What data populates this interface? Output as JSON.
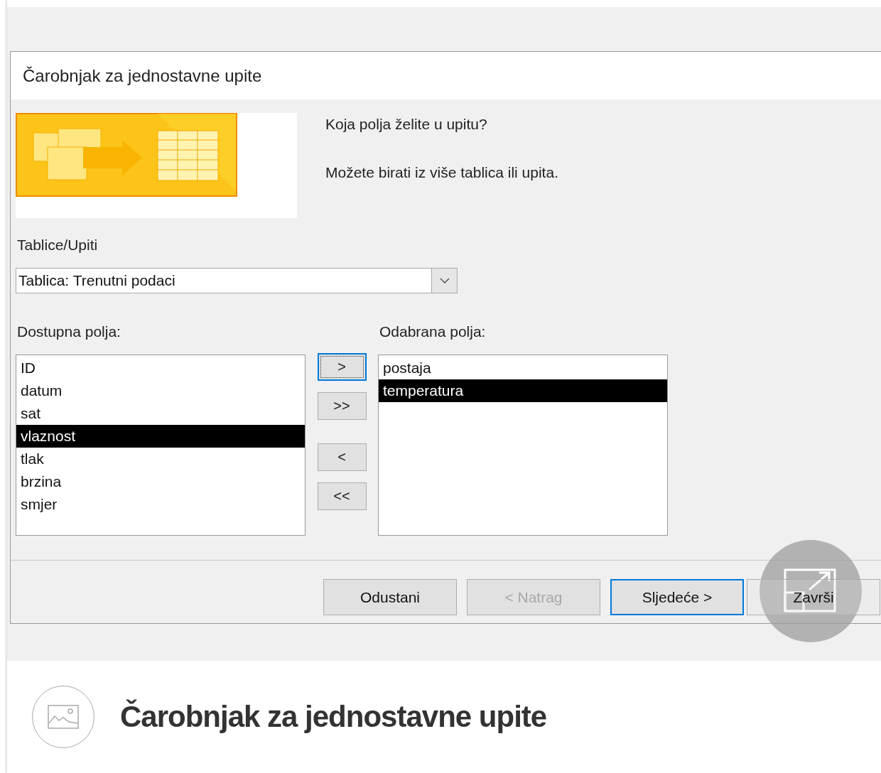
{
  "window": {
    "title": "Čarobnjak za jednostavne upite"
  },
  "header": {
    "question": "Koja polja želite u upitu?",
    "hint": "Možete birati iz više tablica ili upita."
  },
  "tables_label": "Tablice/Upiti",
  "tables_combo": {
    "value": "Tablica: Trenutni podaci"
  },
  "available_fields": {
    "label": "Dostupna polja:",
    "items": [
      {
        "text": "ID",
        "selected": false
      },
      {
        "text": "datum",
        "selected": false
      },
      {
        "text": "sat",
        "selected": false
      },
      {
        "text": "vlaznost",
        "selected": true
      },
      {
        "text": "tlak",
        "selected": false
      },
      {
        "text": "brzina",
        "selected": false
      },
      {
        "text": "smjer",
        "selected": false
      }
    ]
  },
  "move_buttons": [
    {
      "label": ">",
      "focused": true
    },
    {
      "label": ">>",
      "focused": false
    },
    {
      "label": "<",
      "focused": false
    },
    {
      "label": "<<",
      "focused": false
    }
  ],
  "chosen_fields": {
    "label": "Odabrana polja:",
    "items": [
      {
        "text": "postaja",
        "selected": false
      },
      {
        "text": "temperatura",
        "selected": true
      }
    ]
  },
  "buttons": [
    {
      "label": "Odustani",
      "disabled": false,
      "focused": false
    },
    {
      "label": "< Natrag",
      "disabled": true,
      "focused": false
    },
    {
      "label": "Sljedeće >",
      "disabled": false,
      "focused": true
    },
    {
      "label": "Završi",
      "disabled": false,
      "focused": false
    }
  ],
  "caption": {
    "title": "Čarobnjak za jednostavne upite"
  }
}
